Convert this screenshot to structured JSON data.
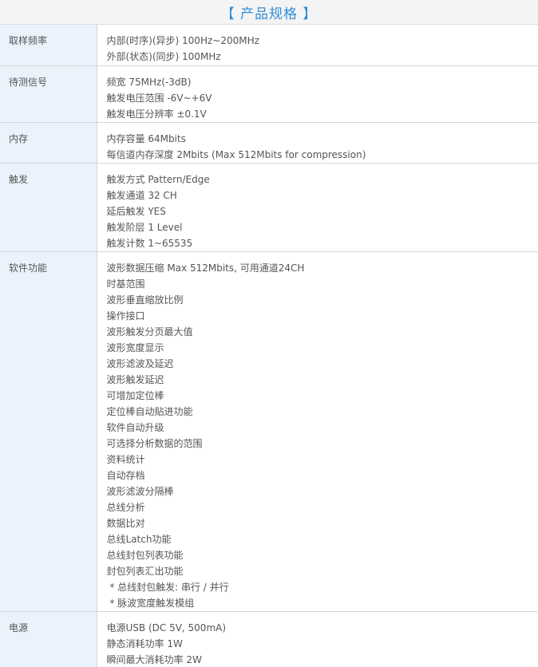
{
  "title": "【 产品规格 】",
  "rows": [
    {
      "label": "取样频率",
      "values": [
        "内部(时序)(异步) 100Hz~200MHz",
        "外部(状态)(同步) 100MHz"
      ]
    },
    {
      "label": "待测信号",
      "values": [
        "频宽 75MHz(-3dB)",
        "触发电压范围 -6V~+6V",
        "触发电压分辨率 ±0.1V"
      ]
    },
    {
      "label": "内存",
      "values": [
        "内存容量 64Mbits",
        "每信道内存深度 2Mbits (Max 512Mbits for compression)"
      ]
    },
    {
      "label": "触发",
      "values": [
        "触发方式 Pattern/Edge",
        "触发通道 32 CH",
        "延后触发 YES",
        "触发阶层 1 Level",
        "触发计数 1~65535"
      ]
    },
    {
      "label": "软件功能",
      "values": [
        "波形数据压缩 Max 512Mbits, 可用通道24CH",
        "时基范围",
        "波形垂直缩放比例",
        "操作接口",
        "波形触发分页最大值",
        "波形宽度显示",
        "波形滤波及延迟",
        "波形触发延迟",
        "可增加定位棒",
        "定位棒自动贴进功能",
        "软件自动升级",
        "可选择分析数据的范围",
        "资料统计",
        "自动存档",
        "波形滤波分隔棒",
        "总线分析",
        "数据比对",
        "总线Latch功能",
        "总线封包列表功能",
        "封包列表汇出功能",
        " * 总线封包触发: 串行 / 并行",
        " * 脉波宽度触发模组"
      ]
    },
    {
      "label": "电源",
      "values": [
        "电源USB (DC 5V, 500mA)",
        "静态消耗功率 1W",
        "瞬间最大消耗功率 2W"
      ]
    }
  ]
}
